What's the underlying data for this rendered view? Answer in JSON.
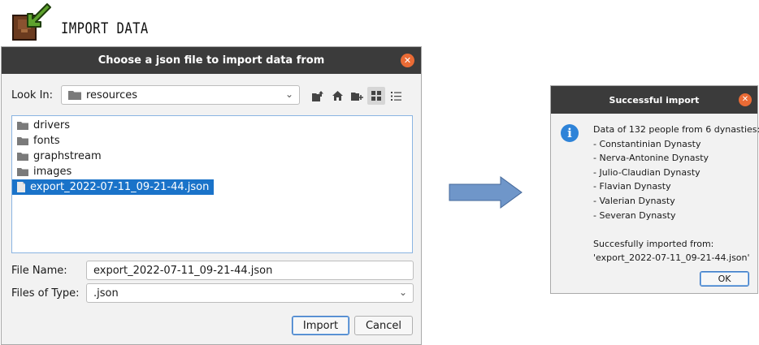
{
  "header": {
    "title": "IMPORT DATA",
    "icon": "import-arrow-box-icon"
  },
  "chooser": {
    "title": "Choose a json file to import data from",
    "look_in_label": "Look In:",
    "look_in_value": "resources",
    "toolbar": [
      {
        "name": "up-folder-icon"
      },
      {
        "name": "home-icon"
      },
      {
        "name": "new-folder-icon"
      },
      {
        "name": "list-view-icon"
      },
      {
        "name": "details-view-icon"
      }
    ],
    "files": [
      {
        "name": "drivers",
        "type": "folder"
      },
      {
        "name": "fonts",
        "type": "folder"
      },
      {
        "name": "graphstream",
        "type": "folder"
      },
      {
        "name": "images",
        "type": "folder"
      },
      {
        "name": "export_2022-07-11_09-21-44.json",
        "type": "file",
        "selected": true
      }
    ],
    "file_name_label": "File Name:",
    "file_name_value": "export_2022-07-11_09-21-44.json",
    "files_of_type_label": "Files of Type:",
    "files_of_type_value": ".json",
    "import_label": "Import",
    "cancel_label": "Cancel"
  },
  "success": {
    "title": "Successful import",
    "lines": [
      "Data of 132 people from 6 dynasties:",
      "- Constantinian Dynasty",
      "- Nerva-Antonine Dynasty",
      "- Julio-Claudian Dynasty",
      "- Flavian Dynasty",
      "- Valerian Dynasty",
      "- Severan Dynasty",
      "",
      "Succesfully imported from:",
      "'export_2022-07-11_09-21-44.json'"
    ],
    "ok_label": "OK"
  },
  "colors": {
    "titlebar": "#3b3b3b",
    "close": "#ea6b35",
    "selection": "#1a73c9",
    "info": "#2e83d8",
    "arrow": "#6f96c9"
  }
}
